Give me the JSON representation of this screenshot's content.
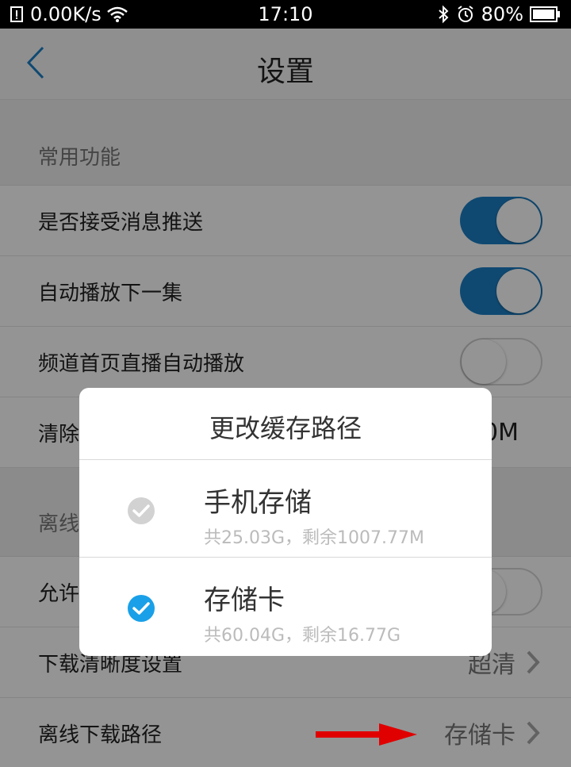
{
  "status_bar": {
    "network_speed": "0.00K/s",
    "time": "17:10",
    "battery": "80%"
  },
  "nav": {
    "title": "设置"
  },
  "sections": {
    "common_header": "常用功能",
    "offline_header": "离线"
  },
  "rows": {
    "push": {
      "label": "是否接受消息推送",
      "toggle_on": true
    },
    "autoplay": {
      "label": "自动播放下一集",
      "toggle_on": true
    },
    "channel_autoplay": {
      "label": "频道首页直播自动播放",
      "toggle_on": false
    },
    "clear": {
      "label": "清除",
      "value": "0M"
    },
    "allow": {
      "label": "允许",
      "toggle_on": false
    },
    "quality": {
      "label": "下载清晰度设置",
      "value": "超清"
    },
    "path": {
      "label": "离线下载路径",
      "value": "存储卡"
    }
  },
  "dialog": {
    "title": "更改缓存路径",
    "options": [
      {
        "name": "手机存储",
        "detail": "共25.03G，剩余1007.77M",
        "selected": false
      },
      {
        "name": "存储卡",
        "detail": "共60.04G，剩余16.77G",
        "selected": true
      }
    ]
  },
  "colors": {
    "accent": "#1b7ec4",
    "check_selected": "#1aa0e8",
    "check_unselected": "#d2d2d2",
    "arrow": "#e00000"
  }
}
